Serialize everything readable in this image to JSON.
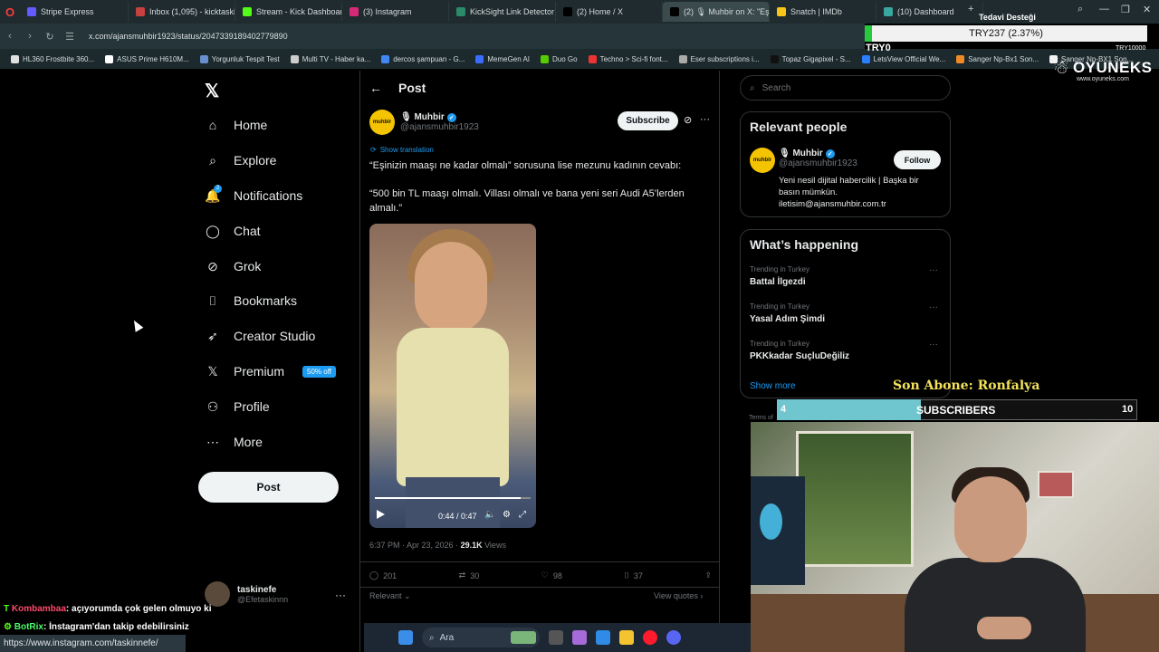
{
  "browser": {
    "tabs": [
      {
        "label": "Stripe Express",
        "color": "#635bff",
        "active": false
      },
      {
        "label": "Inbox (1,095) - kicktaskin",
        "color": "#c74141",
        "active": false
      },
      {
        "label": "Stream - Kick Dashboard",
        "color": "#53fc18",
        "active": false
      },
      {
        "label": "(3) Instagram",
        "color": "#d62976",
        "active": false
      },
      {
        "label": "KickSight Link Detector",
        "color": "#2a8a6a",
        "active": false
      },
      {
        "label": "(2) Home / X",
        "color": "#000000",
        "active": false
      },
      {
        "label": "(2) 🎙 Muhbir on X: \"Eşi",
        "color": "#000000",
        "active": true
      },
      {
        "label": "Snatch | IMDb",
        "color": "#f5c518",
        "active": false
      },
      {
        "label": "(10) Dashboard",
        "color": "#3aa6a0",
        "active": false
      }
    ],
    "url": "x.com/ajansmuhbir1923/status/2047339189402779890",
    "bookmarks": [
      {
        "label": "HL360 Frostbite 360...",
        "color": "#e0e0e0"
      },
      {
        "label": "ASUS Prime H610M...",
        "color": "#ffffff"
      },
      {
        "label": "Yorgunluk Tespit Test",
        "color": "#6a8fd0"
      },
      {
        "label": "Multi TV - Haber ka...",
        "color": "#cccccc"
      },
      {
        "label": "dercos şampuan - G...",
        "color": "#4285f4"
      },
      {
        "label": "MemeGen AI",
        "color": "#3b6cff"
      },
      {
        "label": "Duo Go",
        "color": "#58cc02"
      },
      {
        "label": "Techno > Sci-fi font...",
        "color": "#e33"
      },
      {
        "label": "Eser subscriptions i...",
        "color": "#aaaaaa"
      },
      {
        "label": "Topaz Gigapixel - S...",
        "color": "#111111"
      },
      {
        "label": "LetsView Official We...",
        "color": "#2a7fff"
      },
      {
        "label": "Sanger Np-Bx1 Son...",
        "color": "#f08a24"
      },
      {
        "label": "Sanger Np-BX1 Son...",
        "color": "#f2f2f2"
      }
    ],
    "new_tab": "+",
    "window_min": "—",
    "window_max": "❐",
    "window_close": "✕"
  },
  "overlay": {
    "tedavi": "Tedavi Desteği",
    "ticker_value": "TRY237 (2.37%)",
    "ticker_left": "TRY0",
    "ticker_right": "TRY10000",
    "brand": "OYUNEKS",
    "brand_sub": "www.oyuneks.com",
    "son_abone": "Son Abone: Ronfalya",
    "sub_left": "4",
    "sub_center": "SUBSCRIBERS",
    "sub_right": "10",
    "sub_progress": 0.4
  },
  "xnav": {
    "items": [
      {
        "label": "Home",
        "icon": "home-icon",
        "glyph": "⌂"
      },
      {
        "label": "Explore",
        "icon": "search-icon",
        "glyph": "⌕"
      },
      {
        "label": "Notifications",
        "icon": "bell-icon",
        "glyph": "🔔"
      },
      {
        "label": "Chat",
        "icon": "chat-icon",
        "glyph": "◯"
      },
      {
        "label": "Grok",
        "icon": "grok-icon",
        "glyph": "⊘"
      },
      {
        "label": "Bookmarks",
        "icon": "bookmark-icon",
        "glyph": "⌷"
      },
      {
        "label": "Creator Studio",
        "icon": "rocket-icon",
        "glyph": "➶"
      },
      {
        "label": "Premium",
        "icon": "x-logo-icon",
        "glyph": "𝕏"
      },
      {
        "label": "Profile",
        "icon": "person-icon",
        "glyph": "⚇"
      },
      {
        "label": "More",
        "icon": "more-circle-icon",
        "glyph": "⋯"
      }
    ],
    "notif_count": "2",
    "premium_badge": "50% off",
    "post_label": "Post",
    "account_name": "taskinefe",
    "account_handle": "@Efetaskinnn",
    "account_more": "···"
  },
  "post": {
    "header_title": "Post",
    "author_name": "🎙 Muhbir",
    "author_handle": "@ajansmuhbir1923",
    "logo_text": "muhbir",
    "subscribe_label": "Subscribe",
    "show_translation": "Show translation",
    "text_line1": "“Eşinizin maaşı ne kadar olmalı” sorusuna lise mezunu kadının cevabı:",
    "text_line2": "“500 bin TL maaşı olmalı. Villası olmalı ve bana yeni seri Audi A5’lerden almalı.”",
    "video_time": "0:44 / 0:47",
    "video_progress": 0.936,
    "timestamp": "6:37 PM · Apr 23, 2026 · ",
    "views_count": "29.1K",
    "views_label": " Views",
    "replies": "201",
    "reposts": "30",
    "likes": "98",
    "bookmarks": "37",
    "relevant": "Relevant ⌄",
    "view_quotes": "View quotes ›"
  },
  "right": {
    "search_placeholder": "Search",
    "relevant_title": "Relevant people",
    "rp_name": "🎙 Muhbir",
    "rp_handle": "@ajansmuhbir1923",
    "rp_follow": "Follow",
    "rp_bio": "Yeni nesil dijital habercilik | Başka bir basın mümkün. iletisim@ajansmuhbir.com.tr",
    "happening_title": "What’s happening",
    "trends": [
      {
        "meta": "Trending in Turkey",
        "name": "Battal İlgezdi"
      },
      {
        "meta": "Trending in Turkey",
        "name": "Yasal Adım Şimdi"
      },
      {
        "meta": "Trending in Turkey",
        "name": "PKKkadar SuçluDeğiliz"
      }
    ],
    "show_more": "Show more",
    "terms": "Terms of"
  },
  "chat": {
    "line1_user": "Kombambaa",
    "line1_text": ": açıyorumda çok gelen olmuyo ki",
    "line2_user": "BotRix",
    "line2_text": ": İnstagram'dan takip edebilirsiniz",
    "status_url": "https://www.instagram.com/taskinnefe/"
  },
  "taskbar": {
    "search_placeholder": "Ara"
  }
}
